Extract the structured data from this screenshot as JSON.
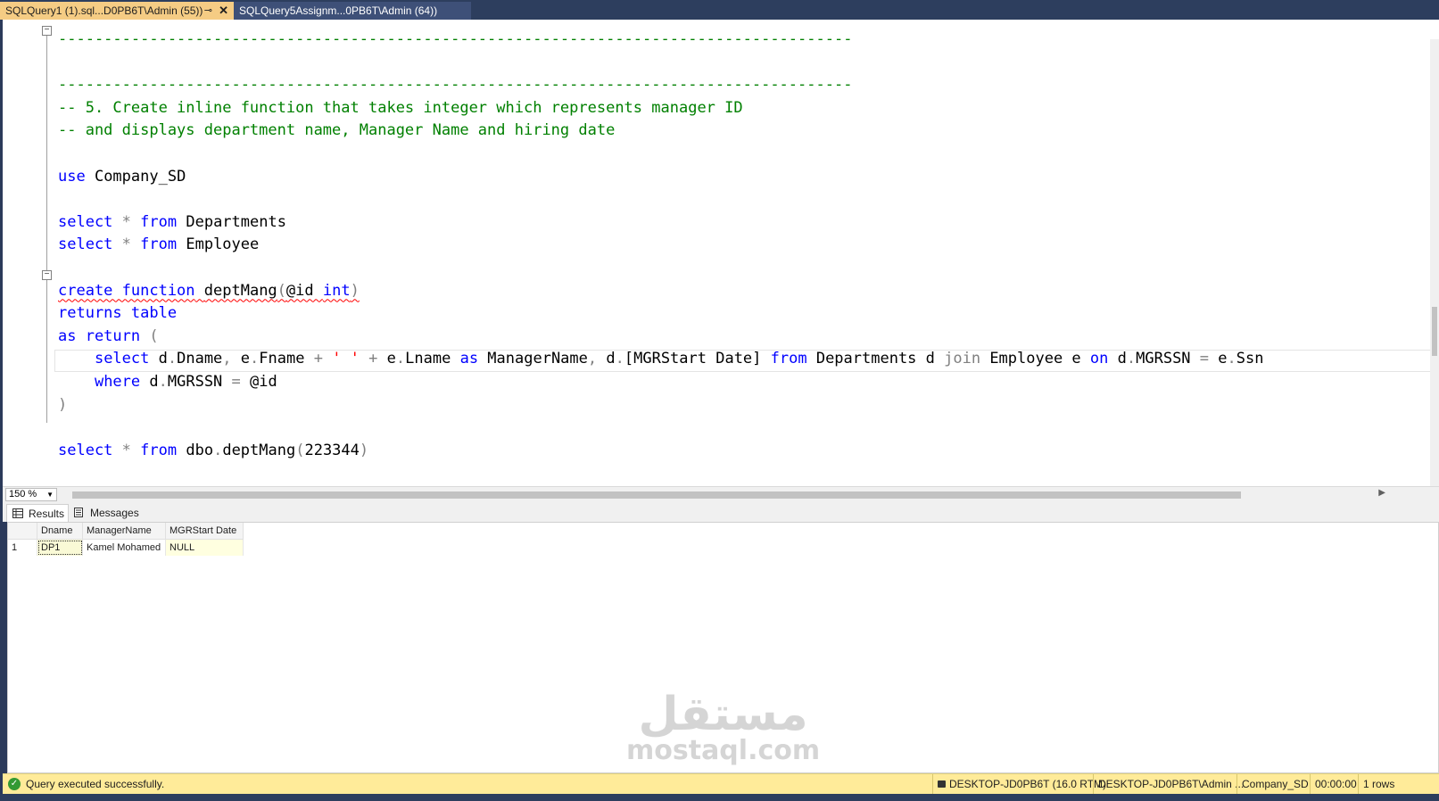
{
  "tabs": [
    {
      "label": "SQLQuery1 (1).sql...D0PB6T\\Admin (55))",
      "pin": "⊸",
      "close": "✕"
    },
    {
      "label": "SQLQuery5Assignm...0PB6T\\Admin (64))"
    }
  ],
  "editor": {
    "code_lines": [
      {
        "segments": [
          {
            "t": "---------------------------------------------------------------------------------------",
            "c": "cm"
          }
        ]
      },
      {
        "segments": []
      },
      {
        "segments": [
          {
            "t": "---------------------------------------------------------------------------------------",
            "c": "cm"
          }
        ]
      },
      {
        "segments": [
          {
            "t": "-- 5. Create inline function that takes integer which represents manager ID",
            "c": "cm"
          }
        ]
      },
      {
        "segments": [
          {
            "t": "-- and displays department name, Manager Name and hiring date",
            "c": "cm"
          }
        ]
      },
      {
        "segments": []
      },
      {
        "segments": [
          {
            "t": "use",
            "c": "kw"
          },
          {
            "t": " Company_SD",
            "c": ""
          }
        ]
      },
      {
        "segments": []
      },
      {
        "segments": [
          {
            "t": "select",
            "c": "kw"
          },
          {
            "t": " ",
            "c": ""
          },
          {
            "t": "*",
            "c": "op"
          },
          {
            "t": " ",
            "c": ""
          },
          {
            "t": "from",
            "c": "kw"
          },
          {
            "t": " Departments",
            "c": ""
          }
        ]
      },
      {
        "segments": [
          {
            "t": "select",
            "c": "kw"
          },
          {
            "t": " ",
            "c": ""
          },
          {
            "t": "*",
            "c": "op"
          },
          {
            "t": " ",
            "c": ""
          },
          {
            "t": "from",
            "c": "kw"
          },
          {
            "t": " Employee",
            "c": ""
          }
        ]
      },
      {
        "segments": []
      },
      {
        "segments": [
          {
            "t": "create function",
            "c": "kw squig"
          },
          {
            "t": " ",
            "c": "squig"
          },
          {
            "t": "deptMang",
            "c": "squig"
          },
          {
            "t": "(",
            "c": "op squig"
          },
          {
            "t": "@id ",
            "c": "squig"
          },
          {
            "t": "int",
            "c": "kw squig"
          },
          {
            "t": ")",
            "c": "op squig"
          }
        ]
      },
      {
        "segments": [
          {
            "t": "returns table",
            "c": "kw"
          }
        ]
      },
      {
        "segments": [
          {
            "t": "as return",
            "c": "kw"
          },
          {
            "t": " ",
            "c": ""
          },
          {
            "t": "(",
            "c": "op"
          }
        ]
      },
      {
        "segments": [
          {
            "t": "    ",
            "c": ""
          },
          {
            "t": "select",
            "c": "kw"
          },
          {
            "t": " d",
            "c": ""
          },
          {
            "t": ".",
            "c": "op"
          },
          {
            "t": "Dname",
            "c": ""
          },
          {
            "t": ",",
            "c": "op"
          },
          {
            "t": " e",
            "c": ""
          },
          {
            "t": ".",
            "c": "op"
          },
          {
            "t": "Fname ",
            "c": ""
          },
          {
            "t": "+",
            "c": "op"
          },
          {
            "t": " ",
            "c": ""
          },
          {
            "t": "' '",
            "c": "st"
          },
          {
            "t": " ",
            "c": ""
          },
          {
            "t": "+",
            "c": "op"
          },
          {
            "t": " e",
            "c": ""
          },
          {
            "t": ".",
            "c": "op"
          },
          {
            "t": "Lname ",
            "c": ""
          },
          {
            "t": "as",
            "c": "kw"
          },
          {
            "t": " ManagerName",
            "c": ""
          },
          {
            "t": ",",
            "c": "op"
          },
          {
            "t": " d",
            "c": ""
          },
          {
            "t": ".",
            "c": "op"
          },
          {
            "t": "[MGRStart Date] ",
            "c": ""
          },
          {
            "t": "from",
            "c": "kw"
          },
          {
            "t": " Departments d ",
            "c": ""
          },
          {
            "t": "join",
            "c": "op"
          },
          {
            "t": " Employee e ",
            "c": ""
          },
          {
            "t": "on",
            "c": "kw"
          },
          {
            "t": " d",
            "c": ""
          },
          {
            "t": ".",
            "c": "op"
          },
          {
            "t": "MGRSSN ",
            "c": ""
          },
          {
            "t": "=",
            "c": "op"
          },
          {
            "t": " e",
            "c": ""
          },
          {
            "t": ".",
            "c": "op"
          },
          {
            "t": "Ssn",
            "c": ""
          }
        ]
      },
      {
        "segments": [
          {
            "t": "    ",
            "c": ""
          },
          {
            "t": "where",
            "c": "kw"
          },
          {
            "t": " d",
            "c": ""
          },
          {
            "t": ".",
            "c": "op"
          },
          {
            "t": "MGRSSN ",
            "c": ""
          },
          {
            "t": "=",
            "c": "op"
          },
          {
            "t": " @id",
            "c": ""
          }
        ]
      },
      {
        "segments": [
          {
            "t": ")",
            "c": "op"
          }
        ]
      },
      {
        "segments": []
      },
      {
        "segments": [
          {
            "t": "select",
            "c": "kw"
          },
          {
            "t": " ",
            "c": ""
          },
          {
            "t": "*",
            "c": "op"
          },
          {
            "t": " ",
            "c": ""
          },
          {
            "t": "from",
            "c": "kw"
          },
          {
            "t": " dbo",
            "c": ""
          },
          {
            "t": ".",
            "c": "op"
          },
          {
            "t": "deptMang",
            "c": ""
          },
          {
            "t": "(",
            "c": "op"
          },
          {
            "t": "223344",
            "c": ""
          },
          {
            "t": ")",
            "c": "op"
          }
        ]
      }
    ]
  },
  "zoom": {
    "value": "150 %"
  },
  "results_tabs": {
    "results": "Results",
    "messages": "Messages"
  },
  "grid": {
    "columns": [
      "Dname",
      "ManagerName",
      "MGRStart Date"
    ],
    "rows": [
      {
        "num": "1",
        "cells": [
          "DP1",
          "Kamel Mohamed",
          "NULL"
        ]
      }
    ]
  },
  "watermark": {
    "arabic": "مستقل",
    "latin": "mostaql.com"
  },
  "status": {
    "message": "Query executed successfully.",
    "server": "DESKTOP-JD0PB6T (16.0 RTM)",
    "login": "DESKTOP-JD0PB6T\\Admin ...",
    "database": "Company_SD",
    "elapsed": "00:00:00",
    "rows": "1 rows"
  }
}
